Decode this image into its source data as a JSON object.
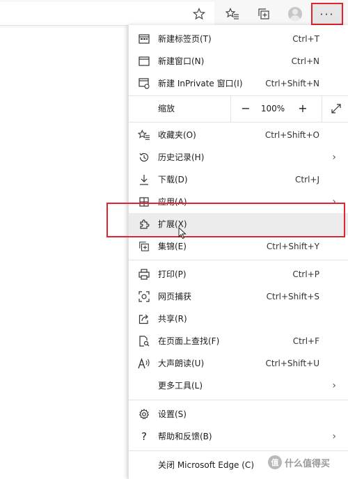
{
  "toolbar": {
    "icons": [
      "favorite-star-icon",
      "favorites-list-icon",
      "collections-icon",
      "profile-avatar-icon",
      "more-options-icon"
    ],
    "more_label": "···"
  },
  "menu": {
    "items_top": [
      {
        "label": "新建标签页(T)",
        "shortcut": "Ctrl+T",
        "icon": "new-tab-icon"
      },
      {
        "label": "新建窗口(N)",
        "shortcut": "Ctrl+N",
        "icon": "new-window-icon"
      },
      {
        "label": "新建 InPrivate 窗口(I)",
        "shortcut": "Ctrl+Shift+N",
        "icon": "inprivate-icon"
      }
    ],
    "zoom": {
      "label": "缩放",
      "minus": "−",
      "value": "100%",
      "plus": "+"
    },
    "items_mid": [
      {
        "label": "收藏夹(O)",
        "shortcut": "Ctrl+Shift+O",
        "icon": "favorites-icon"
      },
      {
        "label": "历史记录(H)",
        "shortcut": "",
        "icon": "history-icon",
        "submenu": true
      },
      {
        "label": "下载(D)",
        "shortcut": "Ctrl+J",
        "icon": "download-icon"
      },
      {
        "label": "应用(A)",
        "shortcut": "",
        "icon": "apps-icon",
        "submenu": true
      },
      {
        "label": "扩展(X)",
        "shortcut": "",
        "icon": "extensions-icon",
        "highlighted": true
      },
      {
        "label": "集锦(E)",
        "shortcut": "Ctrl+Shift+Y",
        "icon": "collections-icon"
      }
    ],
    "items_tools": [
      {
        "label": "打印(P)",
        "shortcut": "Ctrl+P",
        "icon": "print-icon"
      },
      {
        "label": "网页捕获",
        "shortcut": "Ctrl+Shift+S",
        "icon": "web-capture-icon"
      },
      {
        "label": "共享(R)",
        "shortcut": "",
        "icon": "share-icon"
      },
      {
        "label": "在页面上查找(F)",
        "shortcut": "Ctrl+F",
        "icon": "find-icon"
      },
      {
        "label": "大声朗读(U)",
        "shortcut": "Ctrl+Shift+U",
        "icon": "read-aloud-icon"
      },
      {
        "label": "更多工具(L)",
        "shortcut": "",
        "icon": "",
        "submenu": true
      }
    ],
    "items_bottom": [
      {
        "label": "设置(S)",
        "shortcut": "",
        "icon": "settings-icon"
      },
      {
        "label": "帮助和反馈(B)",
        "shortcut": "",
        "icon": "help-icon",
        "submenu": true
      }
    ],
    "close_label": "关闭 Microsoft Edge (C)"
  },
  "chevron": "›",
  "watermark": {
    "logo": "值",
    "text": "什么值得买"
  },
  "colors": {
    "highlight_border": "#e0232c",
    "hover_bg": "#ececec"
  }
}
